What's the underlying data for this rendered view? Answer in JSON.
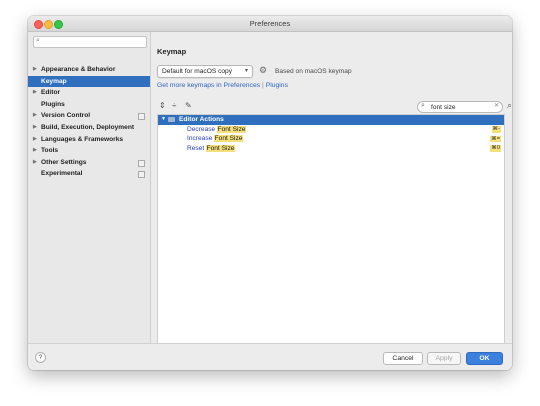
{
  "window": {
    "title": "Preferences"
  },
  "sidebar": {
    "search_placeholder": "",
    "items": [
      {
        "label": "Appearance & Behavior",
        "expandable": true,
        "selected": false,
        "project": false
      },
      {
        "label": "Keymap",
        "expandable": false,
        "selected": true,
        "project": false
      },
      {
        "label": "Editor",
        "expandable": true,
        "selected": false,
        "project": false
      },
      {
        "label": "Plugins",
        "expandable": false,
        "selected": false,
        "project": false
      },
      {
        "label": "Version Control",
        "expandable": true,
        "selected": false,
        "project": true
      },
      {
        "label": "Build, Execution, Deployment",
        "expandable": true,
        "selected": false,
        "project": false
      },
      {
        "label": "Languages & Frameworks",
        "expandable": true,
        "selected": false,
        "project": false
      },
      {
        "label": "Tools",
        "expandable": true,
        "selected": false,
        "project": false
      },
      {
        "label": "Other Settings",
        "expandable": true,
        "selected": false,
        "project": true
      },
      {
        "label": "Experimental",
        "expandable": false,
        "selected": false,
        "project": true
      }
    ]
  },
  "keymap": {
    "header": "Keymap",
    "scheme": "Default for macOS copy",
    "based_on": "Based on macOS keymap",
    "link_more": "Get more keymaps in Preferences",
    "link_sep": "|",
    "link_plugins": "Plugins",
    "filter_value": "font size",
    "group": "Editor Actions",
    "actions": [
      {
        "prefix": "Decrease ",
        "highlight": "Font Size",
        "shortcut": "⌘-"
      },
      {
        "prefix": "Increase ",
        "highlight": "Font Size",
        "shortcut": "⌘="
      },
      {
        "prefix": "Reset ",
        "highlight": "Font Size",
        "shortcut": "⌘0"
      }
    ]
  },
  "buttons": {
    "help": "?",
    "cancel": "Cancel",
    "apply": "Apply",
    "ok": "OK"
  },
  "colors": {
    "selection": "#2f6fbd",
    "highlight": "#f5e07b",
    "link": "#2f63c5",
    "ok": "#3b80dd"
  },
  "icons": [
    "search-icon",
    "gear-icon",
    "expand-all-icon",
    "collapse-all-icon",
    "edit-icon",
    "find-shortcut-icon",
    "folder-icon"
  ]
}
